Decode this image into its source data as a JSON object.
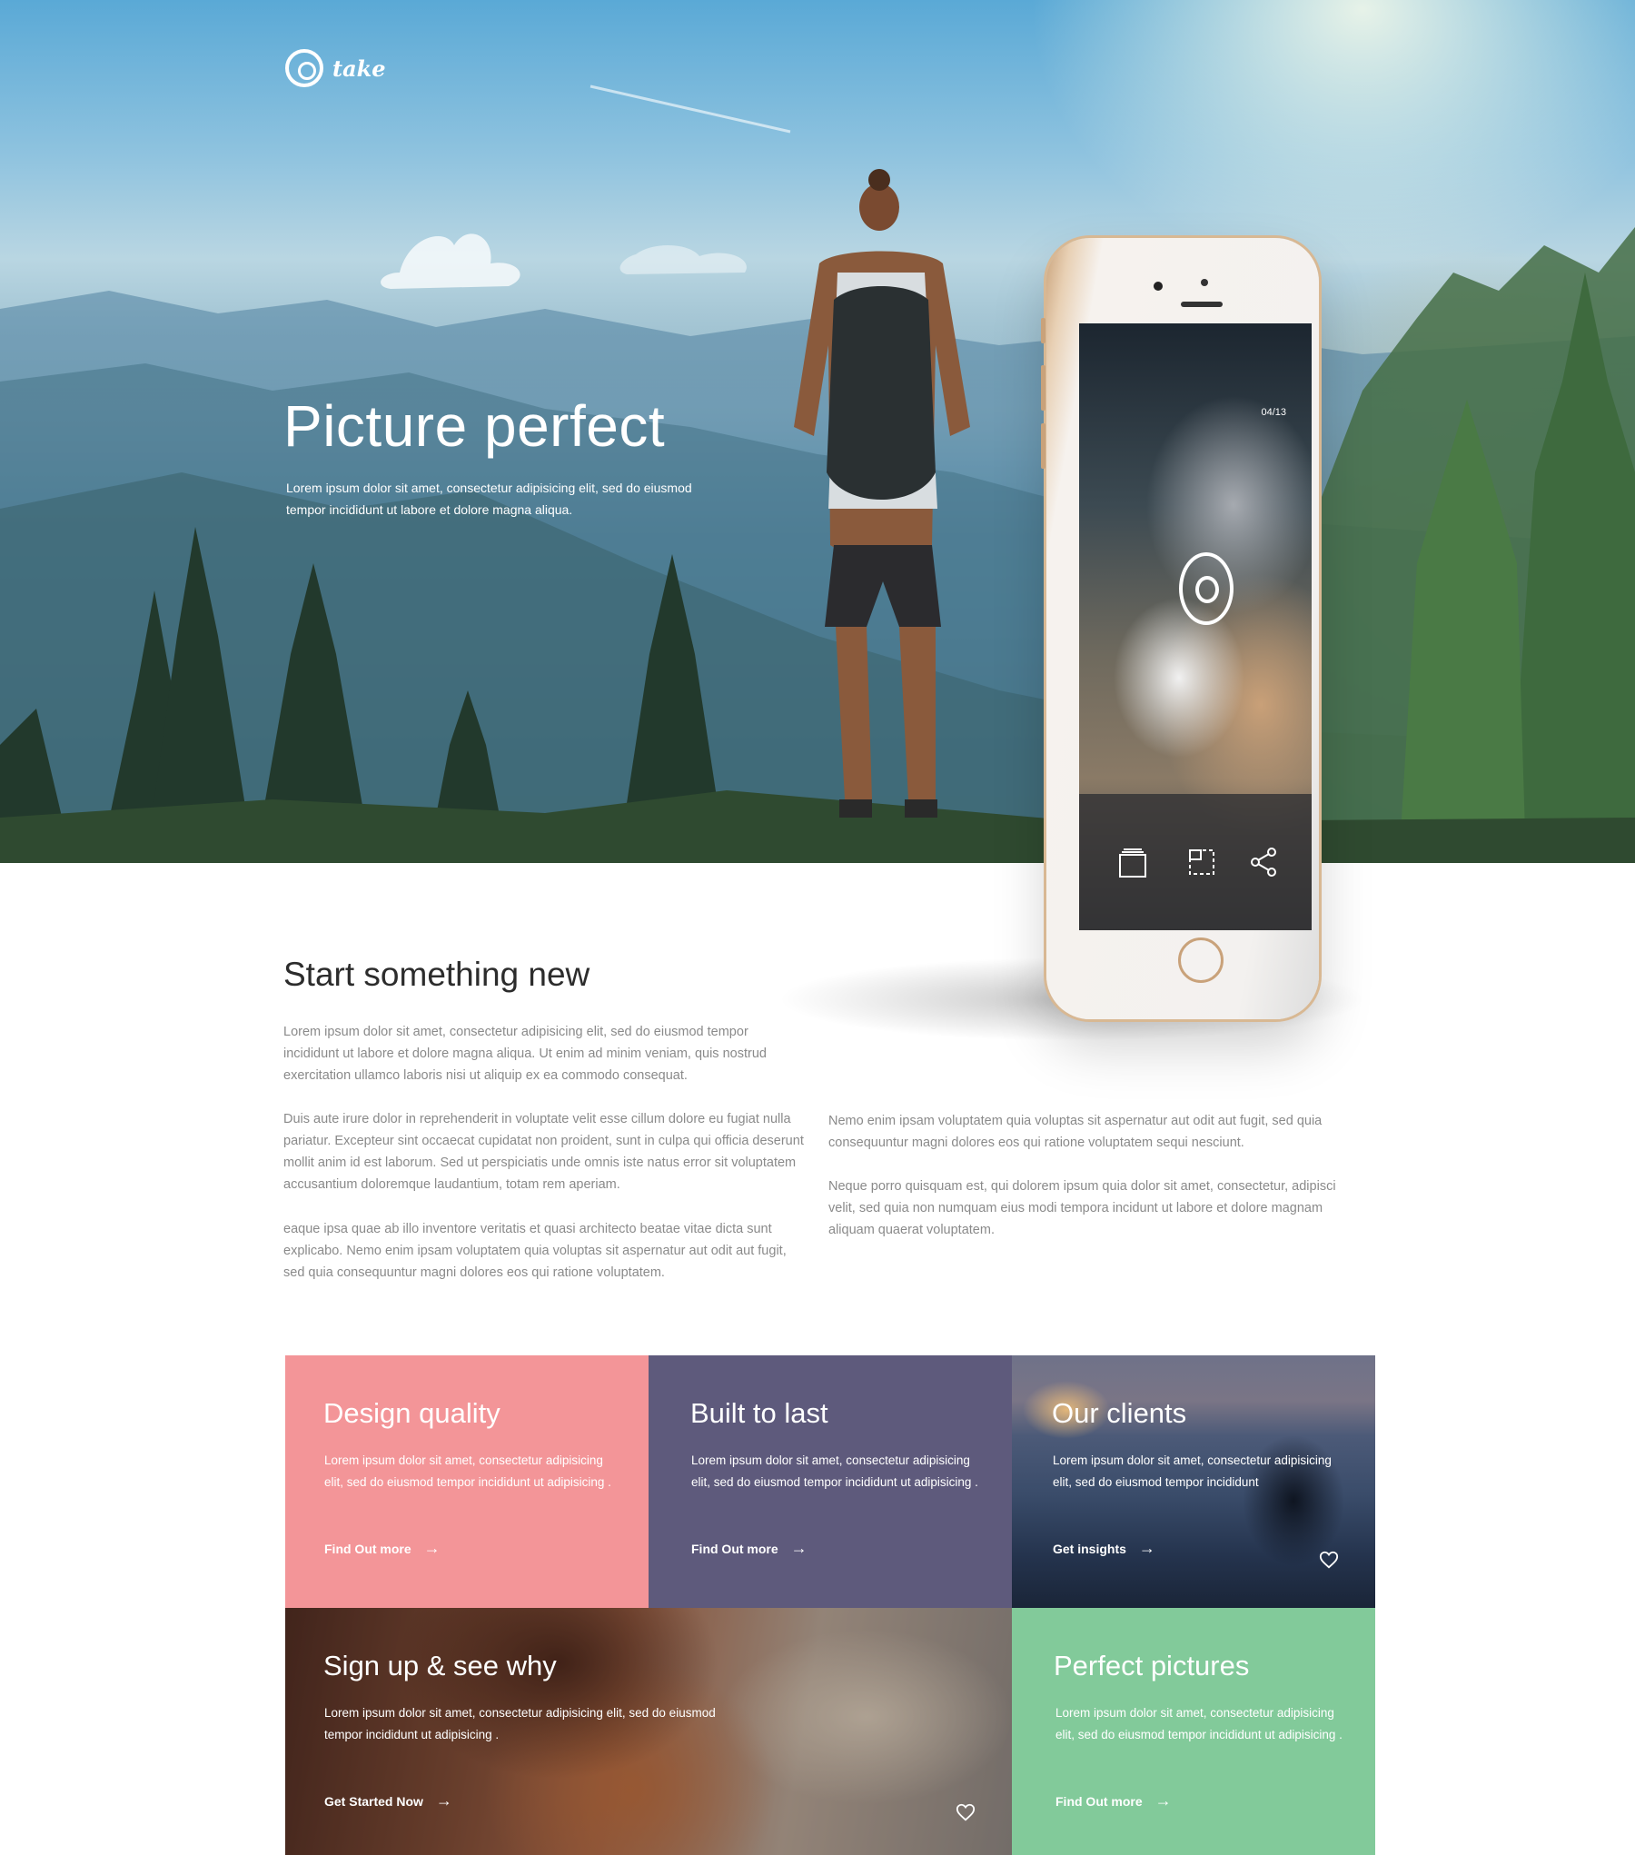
{
  "brand": {
    "name": "take"
  },
  "hero": {
    "title": "Picture perfect",
    "text": "Lorem ipsum dolor sit amet, consectetur adipisicing elit, sed do eiusmod tempor incididunt ut labore et dolore magna aliqua."
  },
  "phone": {
    "counter": "04/13",
    "icons": [
      "gallery-icon",
      "crop-icon",
      "share-icon"
    ]
  },
  "intro": {
    "title": "Start something new",
    "paragraphs": [
      "Lorem ipsum dolor sit amet, consectetur adipisicing elit, sed do eiusmod tempor incididunt ut labore et dolore magna aliqua. Ut enim ad minim veniam, quis nostrud exercitation ullamco laboris nisi ut aliquip ex ea commodo consequat.",
      "Duis aute irure dolor in reprehenderit in voluptate velit esse cillum dolore eu fugiat nulla pariatur. Excepteur sint occaecat cupidatat non proident, sunt in culpa qui officia deserunt mollit anim id est laborum. Sed ut perspiciatis unde omnis iste natus error sit voluptatem accusantium doloremque laudantium, totam rem aperiam.",
      " eaque ipsa quae ab illo inventore veritatis et quasi architecto beatae vitae dicta sunt explicabo. Nemo enim ipsam voluptatem quia voluptas sit aspernatur aut odit aut fugit, sed quia consequuntur magni dolores eos qui ratione voluptatem.",
      "Nemo enim ipsam voluptatem quia voluptas sit aspernatur aut odit aut fugit, sed quia consequuntur magni dolores eos qui ratione voluptatem sequi nesciunt.",
      "Neque porro quisquam est, qui dolorem ipsum quia dolor sit amet, consectetur, adipisci velit, sed quia non numquam eius modi tempora incidunt ut labore et dolore magnam aliquam quaerat voluptatem."
    ]
  },
  "cards": [
    {
      "title": "Design quality",
      "text": "Lorem ipsum dolor sit amet, consectetur adipisicing elit, sed do eiusmod tempor incididunt ut adipisicing .",
      "cta": "Find Out more",
      "color": "#f39598"
    },
    {
      "title": "Built to last",
      "text": "Lorem ipsum dolor sit amet, consectetur adipisicing elit, sed do eiusmod tempor incididunt ut adipisicing .",
      "cta": "Find Out more",
      "color": "#5e5a7c"
    },
    {
      "title": "Our clients",
      "text": "Lorem ipsum dolor sit amet, consectetur adipisicing elit, sed do eiusmod tempor incididunt",
      "cta": "Get insights"
    },
    {
      "title": "Sign up & see why",
      "text": "Lorem ipsum dolor sit amet, consectetur adipisicing elit, sed do eiusmod tempor incididunt ut adipisicing .",
      "cta": "Get Started Now"
    },
    {
      "title": "Perfect pictures",
      "text": "Lorem ipsum dolor sit amet, consectetur adipisicing elit, sed do eiusmod tempor incididunt ut adipisicing .",
      "cta": "Find Out more",
      "color": "#82ca9a"
    }
  ],
  "arrow": "→"
}
